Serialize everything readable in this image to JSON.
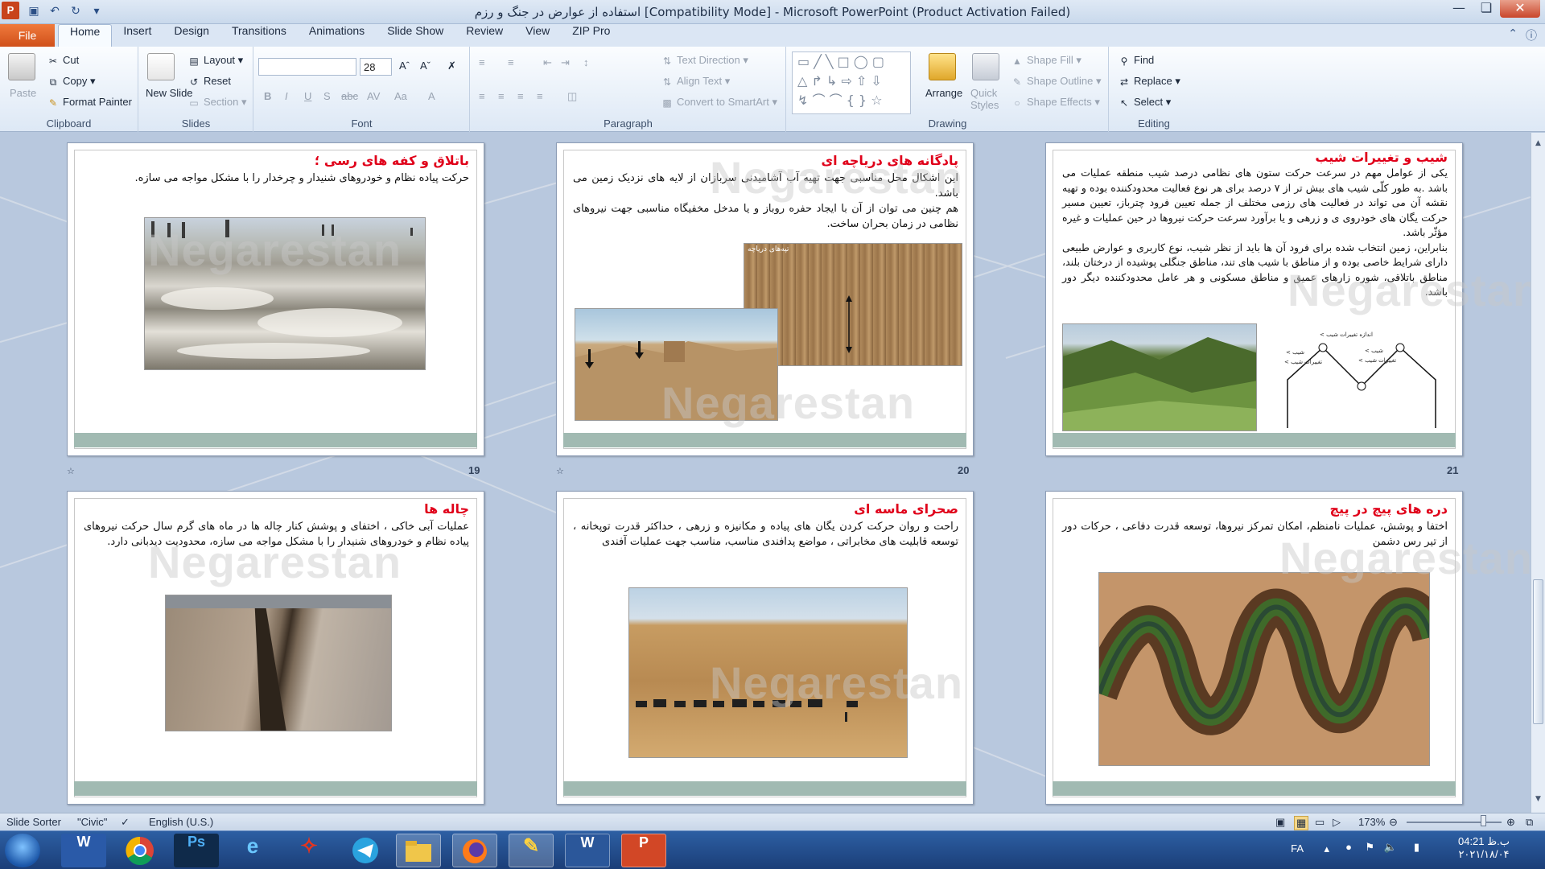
{
  "window": {
    "title": "استفاده از عوارض در جنگ و رزم [Compatibility Mode] - Microsoft PowerPoint (Product Activation Failed)"
  },
  "ribbon": {
    "file_tab": "File",
    "tabs": [
      "Home",
      "Insert",
      "Design",
      "Transitions",
      "Animations",
      "Slide Show",
      "Review",
      "View",
      "ZIP Pro"
    ],
    "clipboard": {
      "paste": "Paste",
      "cut": "Cut",
      "copy": "Copy",
      "format_painter": "Format Painter",
      "label": "Clipboard"
    },
    "slides": {
      "new_slide": "New Slide",
      "layout": "Layout",
      "reset": "Reset",
      "section": "Section",
      "label": "Slides"
    },
    "font": {
      "size": "28",
      "label": "Font"
    },
    "paragraph": {
      "text_direction": "Text Direction",
      "align_text": "Align Text",
      "convert_smartart": "Convert to SmartArt",
      "label": "Paragraph"
    },
    "drawing": {
      "arrange": "Arrange",
      "quick_styles": "Quick Styles",
      "shape_fill": "Shape Fill",
      "shape_outline": "Shape Outline",
      "shape_effects": "Shape Effects",
      "label": "Drawing"
    },
    "editing": {
      "find": "Find",
      "replace": "Replace",
      "select": "Select",
      "label": "Editing"
    }
  },
  "slides": [
    {
      "number": "19",
      "title": "باتلاق و کفه های رسی ؛",
      "body": [
        "حرکت پیاده نظام و خودروهای شنیدار و چرخدار را با مشکل مواجه می سازه."
      ]
    },
    {
      "number": "20",
      "title": "پادگانه های دریاچه ای",
      "body": [
        "این اشکال محل مناسبی جهت تهیه آب آشامیدنی سربازان از لایه های نزدیک زمین می باشد.",
        "هم چنین می توان از آن با ایجاد حفره روباز و یا مدخل مخفیگاه مناسبی جهت نیروهای نظامی در زمان بحران ساخت."
      ],
      "photo_caption": "تپه‌های دریاچه"
    },
    {
      "number": "21",
      "title": "شیب و تغییرات شیب",
      "body": [
        "یکی از عوامل مهم در سرعت حرکت ستون های نظامی درصد شیب منطقه عملیات می باشد .به طور کلّی شیب های بیش تر از ۷ درصد برای هر نوع فعالیت محدودکننده بوده و تهیه نقشه آن می تواند در فعالیت های رزمی مختلف از جمله تعیین فرود چترباز، تعیین مسیر حرکت یگان های خودروی ی و زرهی و یا برآورد سرعت حرکت نیروها در حین عملیات و غیره مؤثّر باشد.",
        "بنابراین، زمین انتخاب شده برای فرود آن ها باید از نظر شیب، نوع کاربری و عوارض طبیعی دارای شرایط خاصی بوده و از مناطق با شیب های تند، مناطق جنگلی پوشیده از درختان بلند، مناطق باتلاقی، شوره زارهای عمیق و مناطق مسکونی و هر عامل محدودکننده دیگر دور باشد."
      ],
      "diagram_labels": [
        "اندازه تغییرات شیب >",
        "شیب > ",
        "تغییرات شیب >",
        "شیب >",
        "تغییرات شیب >"
      ]
    },
    {
      "number": "",
      "title": "چاله ها",
      "body": [
        "عملیات آبی خاکی ، اختفای و پوشش کنار چاله ها در ماه های گرم سال حرکت نیروهای پیاده نظام و خودروهای شنیدار را با مشکل مواجه می سازه، محدودیت دیدبانی دارد."
      ]
    },
    {
      "number": "",
      "title": "صحرای ماسه ای",
      "body": [
        "راحت و روان حرکت کردن یگان های پیاده و مکانیزه و زرهی ، حداکثر قدرت توپخانه ، توسعه قابلیت های مخابراتی ، مواضع پدافندی مناسب، مناسب جهت عملیات آفندی"
      ]
    },
    {
      "number": "",
      "title": "دره های پیچ در پیچ",
      "body": [
        "اختفا و پوشش، عملیات نامنظم، امکان تمرکز نیروها، توسعه قدرت دفاعی ، حرکات دور از تیر رس دشمن"
      ]
    }
  ],
  "watermark": "Negarestan",
  "status": {
    "view": "Slide Sorter",
    "theme": "\"Civic\"",
    "language": "English (U.S.)",
    "zoom": "173%"
  },
  "taskbar": {
    "lang": "FA",
    "time": "04:21 ب.ظ",
    "date": "۲۰۲۱/۱۸/۰۴"
  }
}
